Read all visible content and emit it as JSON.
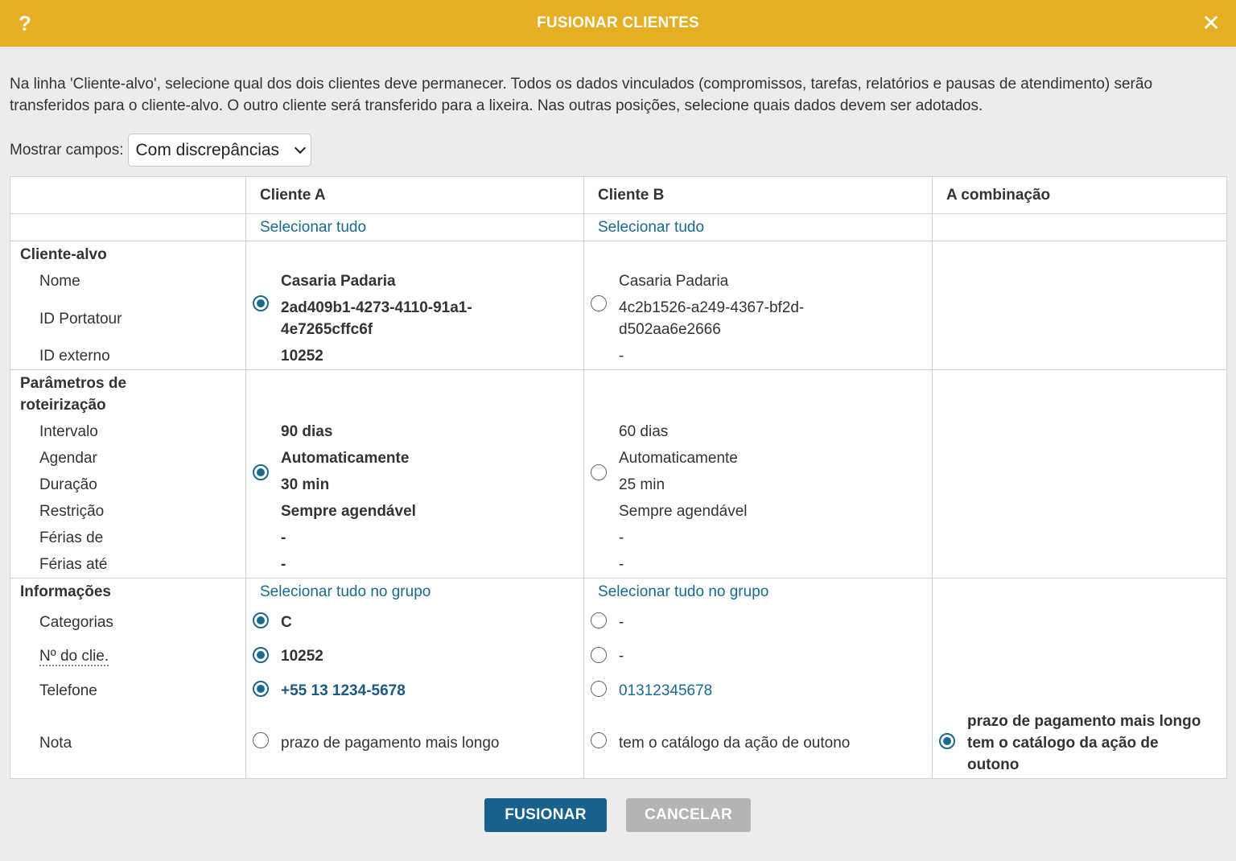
{
  "titlebar": {
    "help_label": "?",
    "title": "FUSIONAR CLIENTES",
    "close_label": "✕"
  },
  "intro_text": "Na linha 'Cliente-alvo', selecione qual dos dois clientes deve permanecer. Todos os dados vinculados (compromissos, tarefas, relatórios e pausas de atendimento) serão transferidos para o cliente-alvo. O outro cliente será transferido para a lixeira. Nas outras posições, selecione quais dados devem ser adotados.",
  "show_fields": {
    "label": "Mostrar campos:",
    "selected": "Com discrepâncias"
  },
  "table": {
    "headers": [
      "",
      "Cliente A",
      "Cliente B",
      "A combinação"
    ],
    "select_all_label": "Selecionar tudo",
    "select_all_group_label": "Selecionar tudo no grupo",
    "target": {
      "title": "Cliente-alvo",
      "fields": [
        "Nome",
        "ID Portatour",
        "ID externo"
      ],
      "a": {
        "nome": "Casaria Padaria",
        "id_line1": "2ad409b1-4273-4110-91a1-",
        "id_line2": "4e7265cffc6f",
        "ext": "10252",
        "selected": true
      },
      "b": {
        "nome": "Casaria Padaria",
        "id_line1": "4c2b1526-a249-4367-bf2d-",
        "id_line2": "d502aa6e2666",
        "ext": "-",
        "selected": false
      }
    },
    "routing": {
      "title_line1": "Parâmetros de",
      "title_line2": "roteirização",
      "fields": [
        "Intervalo",
        "Agendar",
        "Duração",
        "Restrição",
        "Férias de",
        "Férias até"
      ],
      "a": [
        "90 dias",
        "Automaticamente",
        "30 min",
        "Sempre agendável",
        "-",
        "-"
      ],
      "b": [
        "60 dias",
        "Automaticamente",
        "25 min",
        "Sempre agendável",
        "-",
        "-"
      ]
    },
    "info": {
      "title": "Informações",
      "fields": [
        "Categorias",
        "Nº do clie.",
        "Telefone",
        "Nota"
      ],
      "a": [
        "C",
        "10252",
        "+55 13 1234-5678",
        "prazo de pagamento mais longo"
      ],
      "b": [
        "-",
        "-",
        "01312345678",
        "tem o catálogo da ação de outono"
      ],
      "combined_note_lines": [
        "prazo de pagamento mais longo",
        "tem o catálogo da ação de",
        "outono"
      ]
    }
  },
  "buttons": {
    "merge": "FUSIONAR",
    "cancel": "CANCELAR"
  },
  "colors": {
    "titlebar": "#e5ae23",
    "accent": "#18618c",
    "link": "#1a6a8e",
    "disabled_button": "#b4b4b4"
  }
}
